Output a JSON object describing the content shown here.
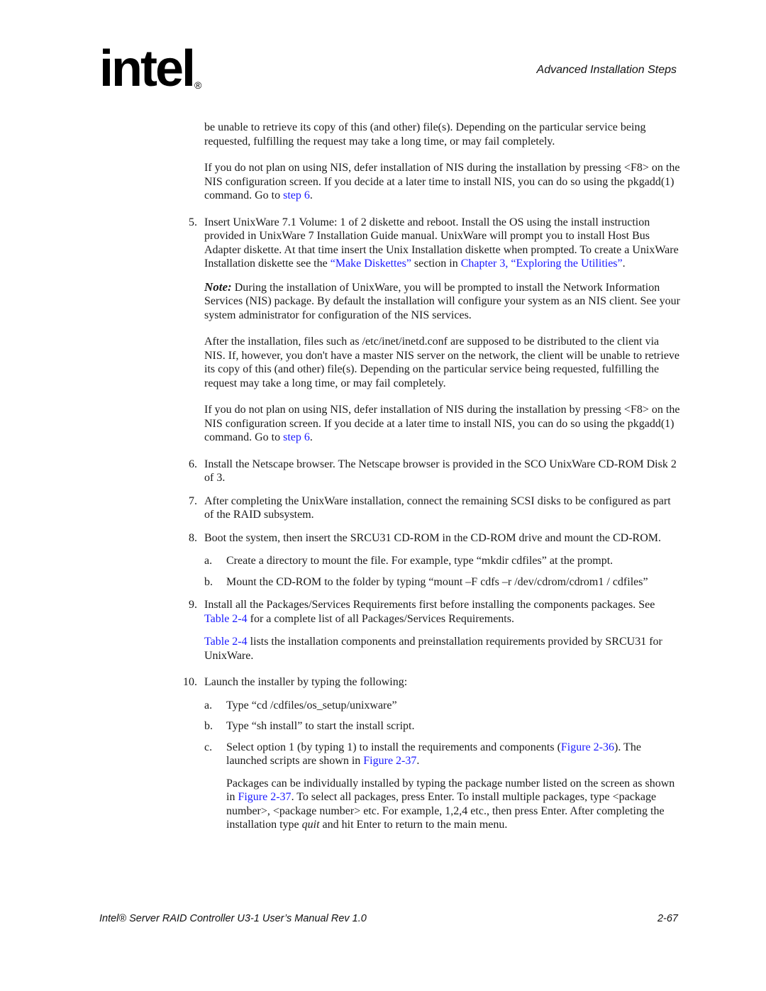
{
  "header": {
    "logo_text": "intel",
    "logo_reg": "®",
    "section_title": "Advanced Installation Steps"
  },
  "body": {
    "p1": "be unable to retrieve its copy of this (and other) file(s). Depending on the particular service being requested, fulfilling the request may take a long time, or may fail completely.",
    "p2_text": "If you do not plan on using NIS, defer installation of NIS during the installation by pressing <F8> on the NIS configuration screen. If you decide at a later time to install NIS, you can do so using the pkgadd(1) command. Go to ",
    "p2_link": "step 6",
    "p2_end": ".",
    "step5": {
      "num": "5.",
      "text": "Insert UnixWare 7.1 Volume: 1 of 2 diskette and reboot. Install the OS using the install instruction provided in UnixWare 7 Installation Guide manual. UnixWare will prompt you to install Host Bus Adapter diskette. At that time insert the Unix Installation diskette when prompted. To create a UnixWare Installation diskette see the ",
      "link1": "“Make Diskettes”",
      "mid": " section in ",
      "link2": "Chapter 3, “Exploring the Utilities”",
      "end": "."
    },
    "note": {
      "label": "Note:",
      "text": " During the installation of UnixWare, you will be prompted to install the Network Information Services (NIS) package. By default the installation will configure your system as an NIS client. See your system administrator for configuration of the NIS services."
    },
    "p3": "After the installation, files such as /etc/inet/inetd.conf are supposed to be distributed to the client via NIS. If, however, you don't have a master NIS server on the network, the client will be unable to retrieve its copy of this (and other) file(s). Depending on the particular service being requested, fulfilling the request may take a long time, or may fail completely.",
    "p4_text": "If you do not plan on using NIS, defer installation of NIS during the installation by pressing <F8> on the NIS configuration screen. If you decide at a later time to install NIS, you can do so using the pkgadd(1) command. Go to ",
    "p4_link": "step 6",
    "p4_end": ".",
    "step6": {
      "num": "6.",
      "text": "Install the Netscape browser. The Netscape browser is provided in the SCO UnixWare CD-ROM Disk 2 of 3."
    },
    "step7": {
      "num": "7.",
      "text": "After completing the UnixWare installation, connect the remaining SCSI disks to be configured as part of the RAID subsystem."
    },
    "step8": {
      "num": "8.",
      "text": "Boot the system, then insert the SRCU31 CD-ROM in the CD-ROM drive and mount the CD-ROM.",
      "a": {
        "num": "a.",
        "text": "Create a directory to mount the file. For example, type “mkdir cdfiles” at the prompt."
      },
      "b": {
        "num": "b.",
        "text": "Mount the CD-ROM to the folder by typing “mount –F cdfs –r /dev/cdrom/cdrom1 / cdfiles”"
      }
    },
    "step9": {
      "num": "9.",
      "text_pre": "Install all the Packages/Services Requirements first before installing the components packages. See ",
      "link": "Table 2-4",
      "text_post": " for a complete list of all Packages/Services Requirements.",
      "p_link": "Table 2-4",
      "p_text": " lists the installation components and preinstallation requirements provided by SRCU31 for UnixWare."
    },
    "step10": {
      "num": "10.",
      "text": "Launch the installer by typing the following:",
      "a": {
        "num": "a.",
        "text": "Type “cd /cdfiles/os_setup/unixware”"
      },
      "b": {
        "num": "b.",
        "text": "Type “sh install” to start the install script."
      },
      "c": {
        "num": "c.",
        "pre": "Select option 1 (by typing 1) to install the requirements and components (",
        "link1": "Figure 2-36",
        "mid": "). The launched scripts are shown in ",
        "link2": "Figure 2-37",
        "end": "."
      },
      "p_pre": "Packages can be individually installed by typing the package number listed on the screen as shown in ",
      "p_link": "Figure 2-37",
      "p_mid": ". To select all packages, press Enter. To install multiple packages, type <package number>, <package number> etc. For example, 1,2,4 etc., then press Enter. After completing the installation type ",
      "p_em": "quit",
      "p_end": " and hit Enter to return to the main menu."
    }
  },
  "footer": {
    "manual_title": "Intel® Server RAID Controller U3-1 User’s Manual Rev 1.0",
    "page_number": "2-67"
  }
}
